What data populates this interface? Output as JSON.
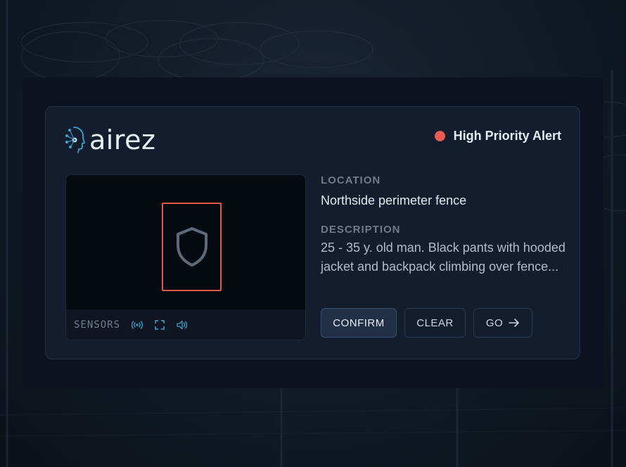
{
  "brand": {
    "name": "airez"
  },
  "alert": {
    "label": "High Priority Alert",
    "color": "#e65b53"
  },
  "video": {
    "detection_icon": "shield-icon",
    "detection_color": "#e05a4c",
    "sensors_label": "SENSORS",
    "sensor_icons": [
      "signal-broadcast-icon",
      "fullscreen-icon",
      "volume-icon"
    ]
  },
  "location": {
    "label": "LOCATION",
    "value": "Northside perimeter fence"
  },
  "description": {
    "label": "DESCRIPTION",
    "value": "25 - 35 y. old man. Black pants with hooded jacket and backpack climbing over fence..."
  },
  "actions": {
    "confirm_label": "CONFIRM",
    "clear_label": "CLEAR",
    "go_label": "GO",
    "go_icon": "arrow-right-icon"
  },
  "colors": {
    "accent": "#3ba3d0",
    "card": "#141d2d"
  }
}
